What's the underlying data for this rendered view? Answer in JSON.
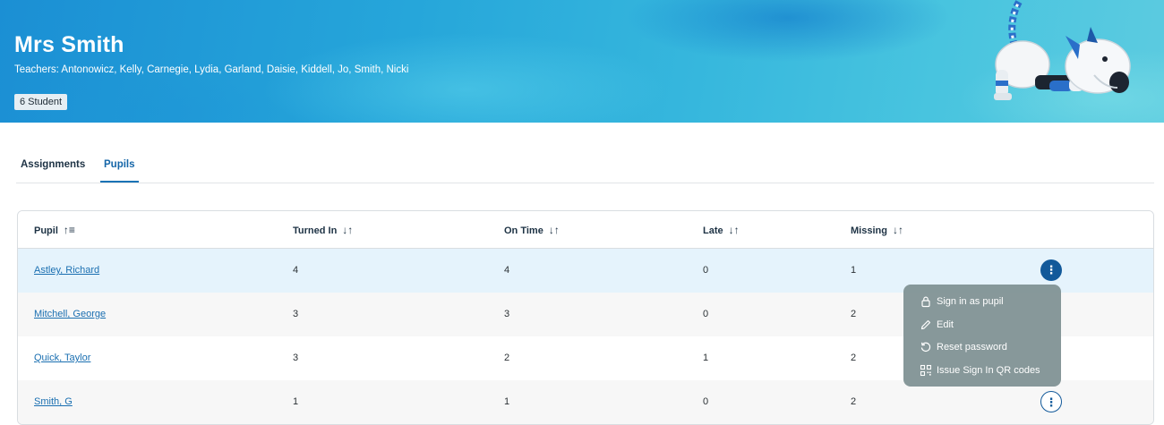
{
  "header": {
    "title": "Mrs Smith",
    "teachers": "Teachers: Antonowicz, Kelly, Carnegie, Lydia, Garland, Daisie, Kiddell, Jo, Smith, Nicki",
    "student_count": "6 Student",
    "mascot_icon": "robot-dog-mascot"
  },
  "tabs": [
    {
      "label": "Assignments",
      "active": false
    },
    {
      "label": "Pupils",
      "active": true
    }
  ],
  "table": {
    "columns": [
      {
        "label": "Pupil",
        "sort_icon": "↑≡"
      },
      {
        "label": "Turned In",
        "sort_icon": "↓↑"
      },
      {
        "label": "On Time",
        "sort_icon": "↓↑"
      },
      {
        "label": "Late",
        "sort_icon": "↓↑"
      },
      {
        "label": "Missing",
        "sort_icon": "↓↑"
      }
    ],
    "rows": [
      {
        "pupil": "Astley, Richard",
        "turned_in": "4",
        "on_time": "4",
        "late": "0",
        "missing": "1"
      },
      {
        "pupil": "Mitchell, George",
        "turned_in": "3",
        "on_time": "3",
        "late": "0",
        "missing": "2"
      },
      {
        "pupil": "Quick, Taylor",
        "turned_in": "3",
        "on_time": "2",
        "late": "1",
        "missing": "2"
      },
      {
        "pupil": "Smith, G",
        "turned_in": "1",
        "on_time": "1",
        "late": "0",
        "missing": "2"
      }
    ],
    "row_menu_glyph": "⋮"
  },
  "row_menu": {
    "items": [
      {
        "label": "Sign in as pupil",
        "icon": "lock-icon"
      },
      {
        "label": "Edit",
        "icon": "pencil-icon"
      },
      {
        "label": "Reset password",
        "icon": "reset-icon"
      },
      {
        "label": "Issue Sign In QR codes",
        "icon": "qr-code-icon"
      }
    ]
  },
  "colors": {
    "accent": "#1a73b5",
    "selected_row": "#e5f3fc",
    "menu_bg": "#829496"
  }
}
